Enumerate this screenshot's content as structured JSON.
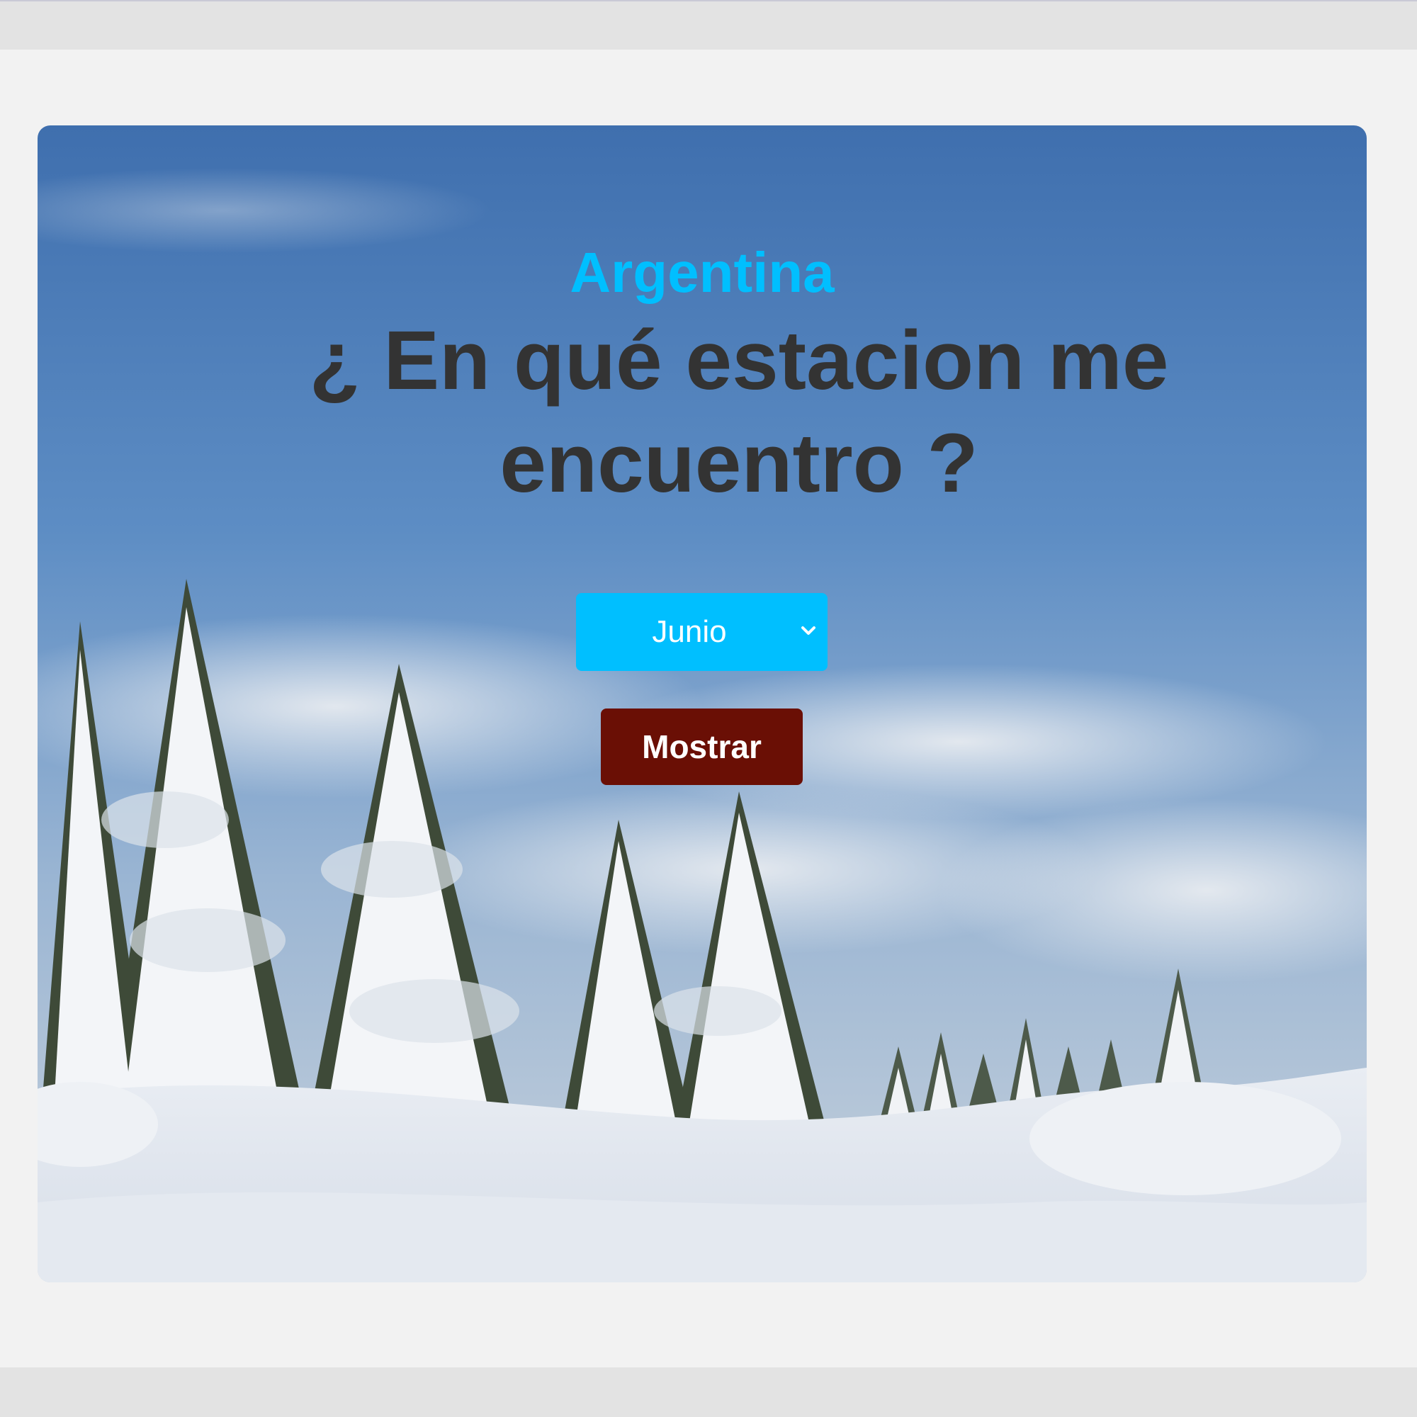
{
  "header": {
    "country": "Argentina",
    "question": "¿ En qué estacion me encuentro ?"
  },
  "form": {
    "month_selected": "Junio",
    "submit_label": "Mostrar"
  },
  "colors": {
    "accent": "#00bfff",
    "button": "#6a0f05",
    "heading": "#333333"
  },
  "icons": {
    "select_arrow": "chevron-down-icon"
  }
}
